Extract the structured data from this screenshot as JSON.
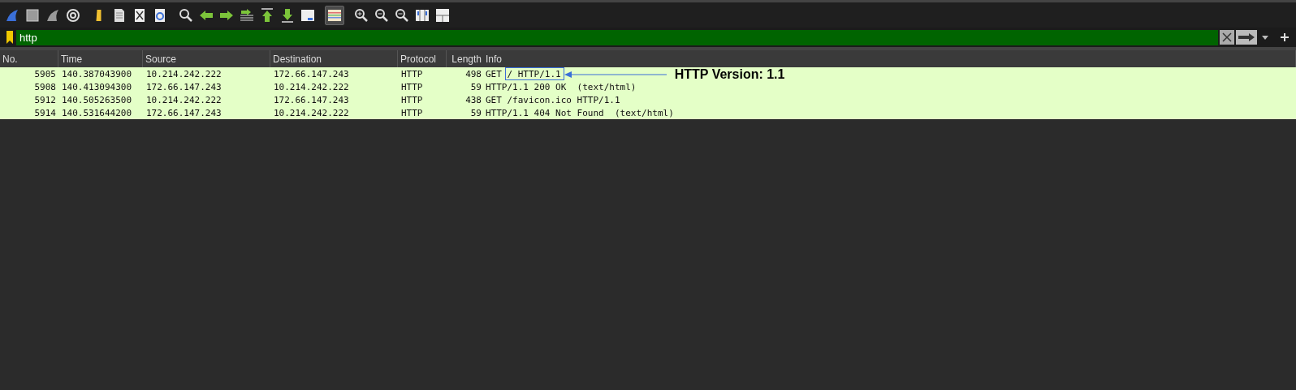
{
  "toolbar": {
    "coloring_rules": {
      "selected": true
    }
  },
  "filter": {
    "value": "http"
  },
  "table": {
    "columns": [
      "No.",
      "Time",
      "Source",
      "Destination",
      "Protocol",
      "Length",
      "Info"
    ],
    "rows": [
      {
        "cells": [
          "5905",
          "140.387043900",
          "10.214.242.222",
          "172.66.147.243",
          "HTTP",
          "498",
          "GET / HTTP/1.1"
        ],
        "annotated": true
      },
      {
        "cells": [
          "5908",
          "140.413094300",
          "172.66.147.243",
          "10.214.242.222",
          "HTTP",
          "59",
          "HTTP/1.1 200 OK  (text/html)"
        ],
        "annotated": false
      },
      {
        "cells": [
          "5912",
          "140.505263500",
          "10.214.242.222",
          "172.66.147.243",
          "HTTP",
          "438",
          "GET /favicon.ico HTTP/1.1"
        ],
        "annotated": false
      },
      {
        "cells": [
          "5914",
          "140.531644200",
          "172.66.147.243",
          "10.214.242.222",
          "HTTP",
          "59",
          "HTTP/1.1 404 Not Found  (text/html)"
        ],
        "annotated": false
      }
    ]
  },
  "annotation": {
    "label": "HTTP Version: 1.1"
  }
}
